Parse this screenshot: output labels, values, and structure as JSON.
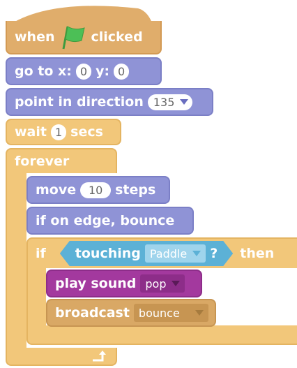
{
  "script": {
    "hat": {
      "when": "when",
      "flag_icon": "green-flag-icon",
      "clicked": "clicked"
    },
    "goto": {
      "prefix": "go to x:",
      "x": "0",
      "y_label": "y:",
      "y": "0"
    },
    "direction": {
      "label": "point in direction",
      "value": "135"
    },
    "wait": {
      "label": "wait",
      "value": "1",
      "unit": "secs"
    },
    "forever": {
      "label": "forever"
    },
    "move": {
      "label": "move",
      "value": "10",
      "unit": "steps"
    },
    "bounce": {
      "label": "if on edge, bounce"
    },
    "if_block": {
      "if_label": "if",
      "then_label": "then"
    },
    "touching": {
      "label": "touching",
      "target": "Paddle",
      "question": "?"
    },
    "play_sound": {
      "label": "play sound",
      "sound": "pop"
    },
    "broadcast": {
      "label": "broadcast",
      "message": "bounce"
    }
  },
  "colors": {
    "events": "#e0ad6b",
    "motion": "#8f93d6",
    "control": "#f2c77a",
    "sound": "#a3399e",
    "sensing": "#5cb1d6"
  }
}
